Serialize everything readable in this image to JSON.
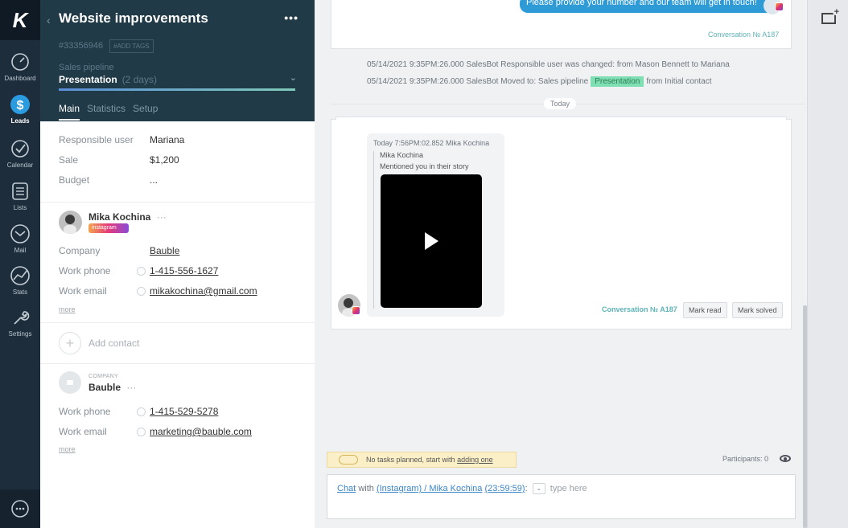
{
  "nav": {
    "items": [
      {
        "label": "Dashboard",
        "icon": "dashboard-icon"
      },
      {
        "label": "Leads",
        "icon": "leads-icon",
        "active": true
      },
      {
        "label": "Calendar",
        "icon": "calendar-icon"
      },
      {
        "label": "Lists",
        "icon": "lists-icon"
      },
      {
        "label": "Mail",
        "icon": "mail-icon"
      },
      {
        "label": "Stats",
        "icon": "stats-icon"
      },
      {
        "label": "Settings",
        "icon": "settings-icon"
      }
    ]
  },
  "lead": {
    "title": "Website improvements",
    "id": "#33356946",
    "add_tags": "#ADD TAGS",
    "pipeline_label": "Sales pipeline",
    "stage": "Presentation",
    "stage_days": "(2 days)",
    "tabs": [
      "Main",
      "Statistics",
      "Setup"
    ],
    "fields": [
      {
        "key": "Responsible user",
        "value": "Mariana"
      },
      {
        "key": "Sale",
        "value": "$1,200"
      },
      {
        "key": "Budget",
        "value": "..."
      }
    ]
  },
  "contact": {
    "name": "Mika Kochina",
    "source_badge": "instagram",
    "company_label": "Company",
    "company": "Bauble",
    "work_phone_label": "Work phone",
    "work_phone": "1-415-556-1627",
    "work_email_label": "Work email",
    "work_email": "mikakochina@gmail.com",
    "more": "more",
    "add_contact": "Add contact"
  },
  "company": {
    "tag": "COMPANY",
    "name": "Bauble",
    "work_phone_label": "Work phone",
    "work_phone": "1-415-529-5278",
    "work_email_label": "Work email",
    "work_email": "marketing@bauble.com",
    "more": "more"
  },
  "feed": {
    "top_bubble": "Please provide your number and our team will get in touch!",
    "top_conv": "Conversation № A187",
    "sys1": "05/14/2021 9:35PM:26.000 SalesBot Responsible user was changed: from Mason Bennett to Mariana",
    "sys2_prefix": "05/14/2021 9:35PM:26.000 SalesBot Moved to:  Sales pipeline",
    "sys2_tag": "Presentation",
    "sys2_suffix": "from Initial contact",
    "today": "Today",
    "msg_header": "Today 7:56PM:02.852 Mika Kochina",
    "msg_who": "Mika Kochina",
    "msg_text": "Mentioned you in their story",
    "conv": "Conversation № A187",
    "mark_read": "Mark read",
    "mark_solved": "Mark solved"
  },
  "footer": {
    "task_text": "No tasks planned, start with",
    "task_link": "adding one",
    "participants": "Participants: 0",
    "chat": "Chat",
    "with": "with",
    "target": "(Instagram) / Mika Kochina",
    "timer": "(23:59:59)",
    "placeholder": "type here"
  }
}
